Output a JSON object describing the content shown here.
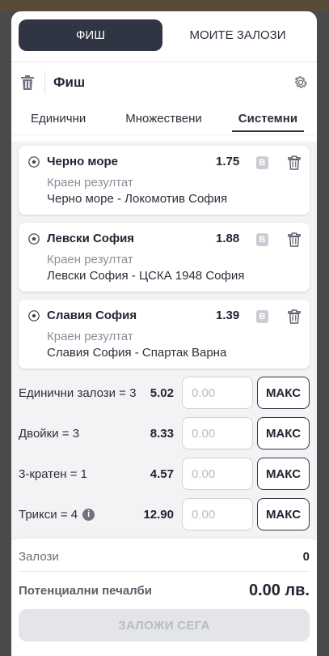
{
  "tabs": {
    "slip": "ФИШ",
    "my_bets": "МОИТЕ ЗАЛОЗИ"
  },
  "header": {
    "title": "Фиш"
  },
  "bet_types": [
    "Единични",
    "Множествени",
    "Системни"
  ],
  "selections": [
    {
      "team": "Черно море",
      "odds": "1.75",
      "badge": "B",
      "market": "Краен резултат",
      "event": "Черно море - Локомотив София"
    },
    {
      "team": "Левски София",
      "odds": "1.88",
      "badge": "B",
      "market": "Краен резултат",
      "event": "Левски София - ЦСКА 1948 София"
    },
    {
      "team": "Славия София",
      "odds": "1.39",
      "badge": "B",
      "market": "Краен резултат",
      "event": "Славия София - Спартак Варна"
    }
  ],
  "systems": [
    {
      "label": "Единични залози = 3",
      "odds": "5.02",
      "placeholder": "0.00",
      "max": "МАКС"
    },
    {
      "label": "Двойки = 3",
      "odds": "8.33",
      "placeholder": "0.00",
      "max": "МАКС"
    },
    {
      "label": "3-кратен = 1",
      "odds": "4.57",
      "placeholder": "0.00",
      "max": "МАКС"
    },
    {
      "label": "Трикси = 4",
      "odds": "12.90",
      "placeholder": "0.00",
      "max": "МАКС"
    }
  ],
  "info_symbol": "i",
  "footer": {
    "stakes_label": "Залози",
    "stakes_value": "0",
    "winnings_label": "Потенциални печалби",
    "winnings_value": "0.00 лв.",
    "place_label": "ЗАЛОЖИ СЕГА"
  },
  "colors": {
    "active_tab": "#2f3542",
    "disabled_button": "#e4e5e8",
    "badge": "#c9ccd3"
  },
  "icons": {
    "trash": "trash-icon",
    "settings": "gear-icon",
    "ball": "soccer-ball-icon",
    "info": "info-icon"
  }
}
